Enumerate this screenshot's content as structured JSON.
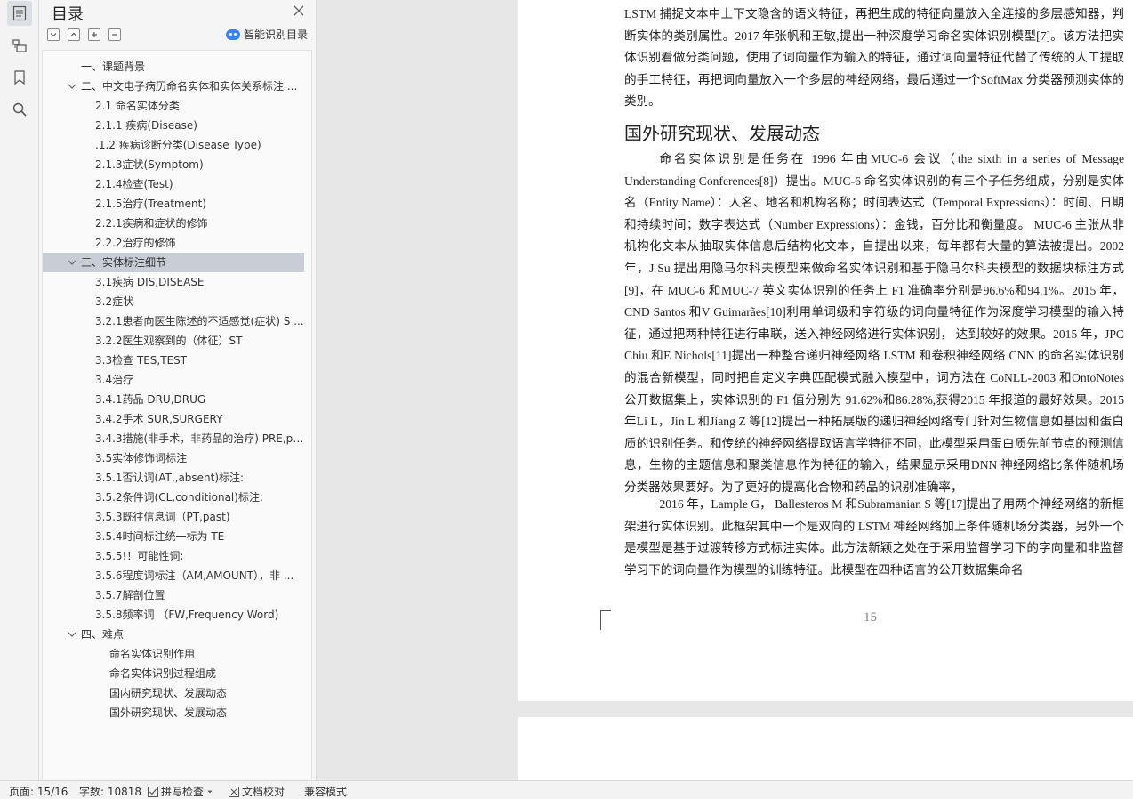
{
  "toc": {
    "title": "目录",
    "smart_label": "智能识别目录",
    "items": [
      {
        "label": "一、课题背景"
      },
      {
        "label": "二、中文电子病历命名实体和实体关系标注 ..."
      },
      {
        "label": "2.1 命名实体分类"
      },
      {
        "label": "2.1.1 疾病(Disease)"
      },
      {
        "label": ".1.2 疾病诊断分类(Disease Type)"
      },
      {
        "label": "2.1.3症状(Symptom)"
      },
      {
        "label": "2.1.4检查(Test)"
      },
      {
        "label": "2.1.5治疗(Treatment)"
      },
      {
        "label": "2.2.1疾病和症状的修饰"
      },
      {
        "label": "2.2.2治疗的修饰"
      },
      {
        "label": "三、实体标注细节"
      },
      {
        "label": "3.1疾病 DIS,DISEASE"
      },
      {
        "label": "3.2症状"
      },
      {
        "label": "3.2.1患者向医生陈述的不适感觉(症状) S ..."
      },
      {
        "label": "3.2.2医生观察到的（体征）ST"
      },
      {
        "label": "3.3检查 TES,TEST"
      },
      {
        "label": "3.4治疗"
      },
      {
        "label": "3.4.1药品 DRU,DRUG"
      },
      {
        "label": "3.4.2手术 SUR,SURGERY"
      },
      {
        "label": "3.4.3措施(非手术，非药品的治疗) PRE,p ..."
      },
      {
        "label": "3.5实体修饰词标注"
      },
      {
        "label": "3.5.1否认词(AT,,absent)标注:"
      },
      {
        "label": "3.5.2条件词(CL,conditional)标注:"
      },
      {
        "label": "3.5.3既往信息词（PT,past)"
      },
      {
        "label": "3.5.4时间标注统一标为 TE"
      },
      {
        "label": "3.5.5!！可能性词:"
      },
      {
        "label": "3.5.6程度词标注（AM,AMOUNT），非 ..."
      },
      {
        "label": "3.5.7解剖位置"
      },
      {
        "label": "3.5.8频率词 （FW,Frequency Word)"
      },
      {
        "label": "四、难点"
      },
      {
        "label": "命名实体识别作用"
      },
      {
        "label": "命名实体识别过程组成"
      },
      {
        "label": "国内研究现状、发展动态"
      },
      {
        "label": "国外研究现状、发展动态"
      }
    ]
  },
  "doc": {
    "para1": "LSTM 捕捉文本中上下文隐含的语义特征，再把生成的特征向量放入全连接的多层感知器，判断实体的类别属性。2017 年张帆和王敏,提出一种深度学习命名实体识别模型[7]。该方法把实体识别看做分类问题，使用了词向量作为输入的特征，通过词向量特征代替了传统的人工提取的手工特征，再把词向量放入一个多层的神经网络，最后通过一个SoftMax 分类器预测实体的类别。",
    "heading": "国外研究现状、发展动态",
    "para2": "命名实体识别是任务在 1996 年由MUC-6 会议（the sixth in a series of Message Understanding Conferences[8]）提出。MUC-6 命名实体识别的有三个子任务组成，分别是实体名（Entity Name）：人名、地名和机构名称；时间表达式（Temporal Expressions）：时间、日期和持续时间；数字表达式（Number Expressions）：金钱，百分比和衡量度。 MUC-6 主张从非机构化文本从抽取实体信息后结构化文本，自提出以来，每年都有大量的算法被提出。2002 年，J Su 提出用隐马尔科夫模型来做命名实体识别和基于隐马尔科夫模型的数据块标注方式[9]，在 MUC-6 和MUC-7 英文实体识别的任务上 F1 准确率分别是96.6%和94.1%。2015 年，CND Santos 和V Guimarães[10]利用单词级和字符级的词向量特征作为深度学习模型的输入特征，通过把两种特征进行串联，送入神经网络进行实体识别， 达到较好的效果。2015 年，JPC Chiu 和E Nichols[11]提出一种整合递归神经网络 LSTM 和卷积神经网络 CNN 的命名实体识别的混合新模型，同时把自定义字典匹配模式融入模型中，词方法在 CoNLL-2003 和OntoNotes 公开数据集上，实体识别的 F1 值分别为 91.62%和86.28%,获得2015 年报道的最好效果。2015 年Li L，Jin L 和Jiang Z 等[12]提出一种拓展版的递归神经网络专门针对生物信息如基因和蛋白质的识别任务。和传统的神经网络提取语言学特征不同，此模型采用蛋白质先前节点的预测信息，生物的主题信息和聚类信息作为特征的输入，结果显示采用DNN 神经网络比条件随机场分类器效果要好。为了更好的提高化合物和药品的识别准确率，",
    "para3": "2016 年，Lample G， Ballesteros M 和Subramanian S 等[17]提出了用两个神经网络的新框架进行实体识别。此框架其中一个是双向的 LSTM 神经网络加上条件随机场分类器，另外一个是模型是基于过渡转移方式标注实体。此方法新颖之处在于采用监督学习下的字向量和非监督学习下的词向量作为模型的训练特征。此模型在四种语言的公开数据集命名",
    "page_number": "15"
  },
  "status": {
    "page": "页面: 15/16",
    "words": "字数: 10818",
    "spell": "拼写检查",
    "proof": "文档校对",
    "compat": "兼容模式"
  }
}
